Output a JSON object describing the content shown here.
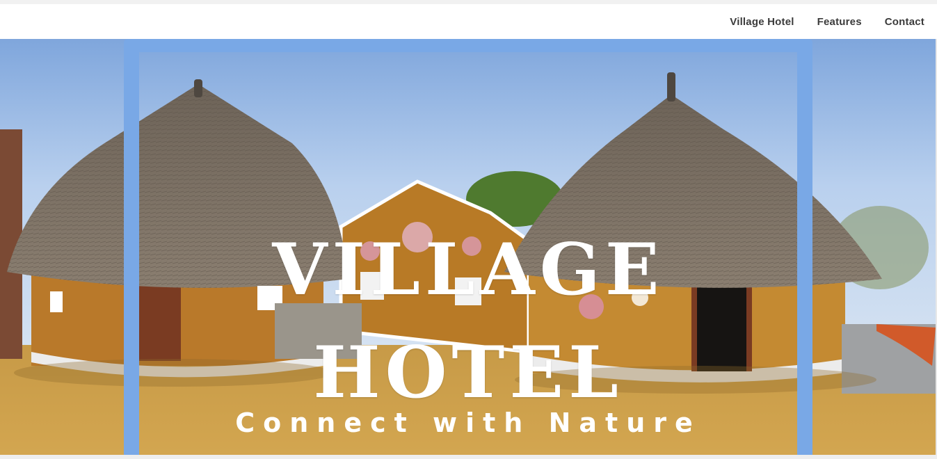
{
  "nav": {
    "items": [
      {
        "label": "Village Hotel"
      },
      {
        "label": "Features"
      },
      {
        "label": "Contact"
      }
    ]
  },
  "hero": {
    "title_line1": "VILLAGE",
    "title_line2": "HOTEL",
    "subtitle": "Connect with Nature",
    "frame_color": "#79a8e6"
  }
}
